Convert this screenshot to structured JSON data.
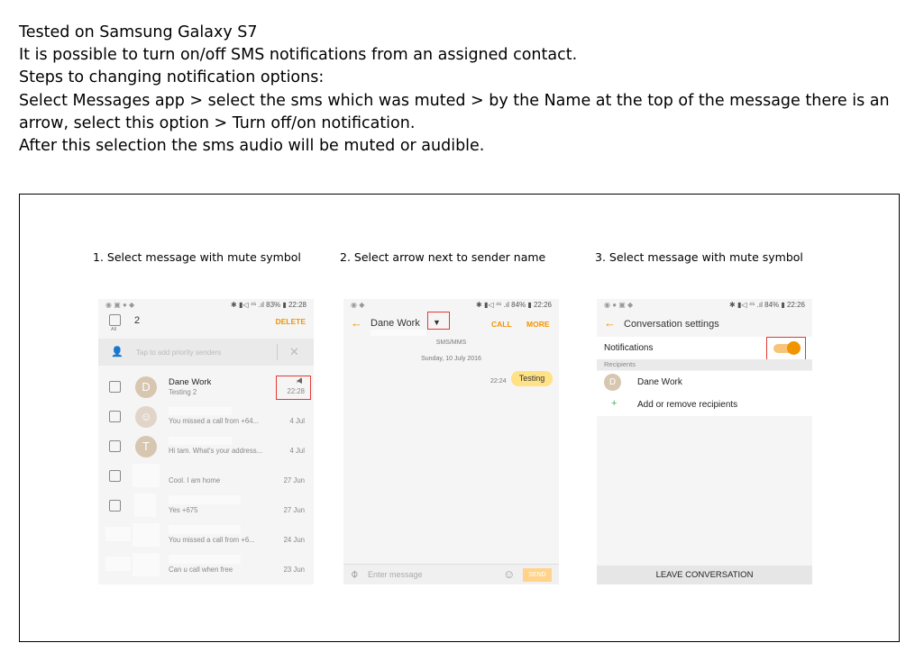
{
  "intro": {
    "line1": "Tested on Samsung Galaxy S7",
    "line2": "It is possible to turn on/off SMS notifications from an assigned contact.",
    "line3": "Steps to changing notification options:",
    "line4": "Select Messages app > select the sms which was muted > by the Name at the top of the message there is an arrow, select this option > Turn off/on notification.",
    "line5": "After this selection the sms audio will be muted or audible."
  },
  "captions": [
    "1. Select message with mute symbol",
    "2. Select arrow next to sender name",
    "3. Select message with mute symbol"
  ],
  "colors": {
    "accent": "#f29400",
    "highlight": "#e53935",
    "bubble": "#ffe285"
  },
  "phone1": {
    "status_right": "✱ ▮◁ ⁴⁶ .ıl 83% ▮ 22:28",
    "selected_count": "2",
    "all_label": "All",
    "delete_label": "DELETE",
    "priority_placeholder": "Tap to add priority senders",
    "conversations": [
      {
        "avatar": "D",
        "name": "Dane Work",
        "preview": "Testing 2",
        "date": "22:28",
        "muted": true,
        "mute_icon": "mute-icon"
      },
      {
        "avatar": "",
        "name": "",
        "preview": "You missed a call from +64...",
        "date": "4 Jul"
      },
      {
        "avatar": "T",
        "name": "",
        "preview": "Hi tam. What's your address...",
        "date": "4 Jul"
      },
      {
        "avatar": "",
        "name": "",
        "preview": "Cool. I am home",
        "date": "27 Jun"
      },
      {
        "avatar": "",
        "name": "",
        "preview": "Yes +675",
        "date": "27 Jun"
      },
      {
        "avatar": "",
        "name": "",
        "preview": "You missed a call from +6...",
        "date": "24 Jun"
      },
      {
        "avatar": "",
        "name": "",
        "preview": "Can u call when free",
        "date": "23 Jun"
      }
    ]
  },
  "phone2": {
    "status_right": "✱ ▮◁ ⁴⁶ .ıl 84% ▮ 22:26",
    "contact_name": "Dane Work",
    "call_label": "CALL",
    "more_label": "MORE",
    "thread_type": "SMS/MMS",
    "date": "Sunday, 10 July 2016",
    "message_time": "22:24",
    "message_text": "Testing",
    "input_placeholder": "Enter message",
    "send_label": "SEND"
  },
  "phone3": {
    "status_right": "✱ ▮◁ ⁴⁶ .ıl 84% ▮ 22:26",
    "title": "Conversation settings",
    "notifications_label": "Notifications",
    "notifications_on": true,
    "recipients_header": "Recipients",
    "recipient_avatar": "D",
    "recipient_name": "Dane Work",
    "add_remove_label": "Add or remove recipients",
    "leave_label": "LEAVE CONVERSATION"
  }
}
